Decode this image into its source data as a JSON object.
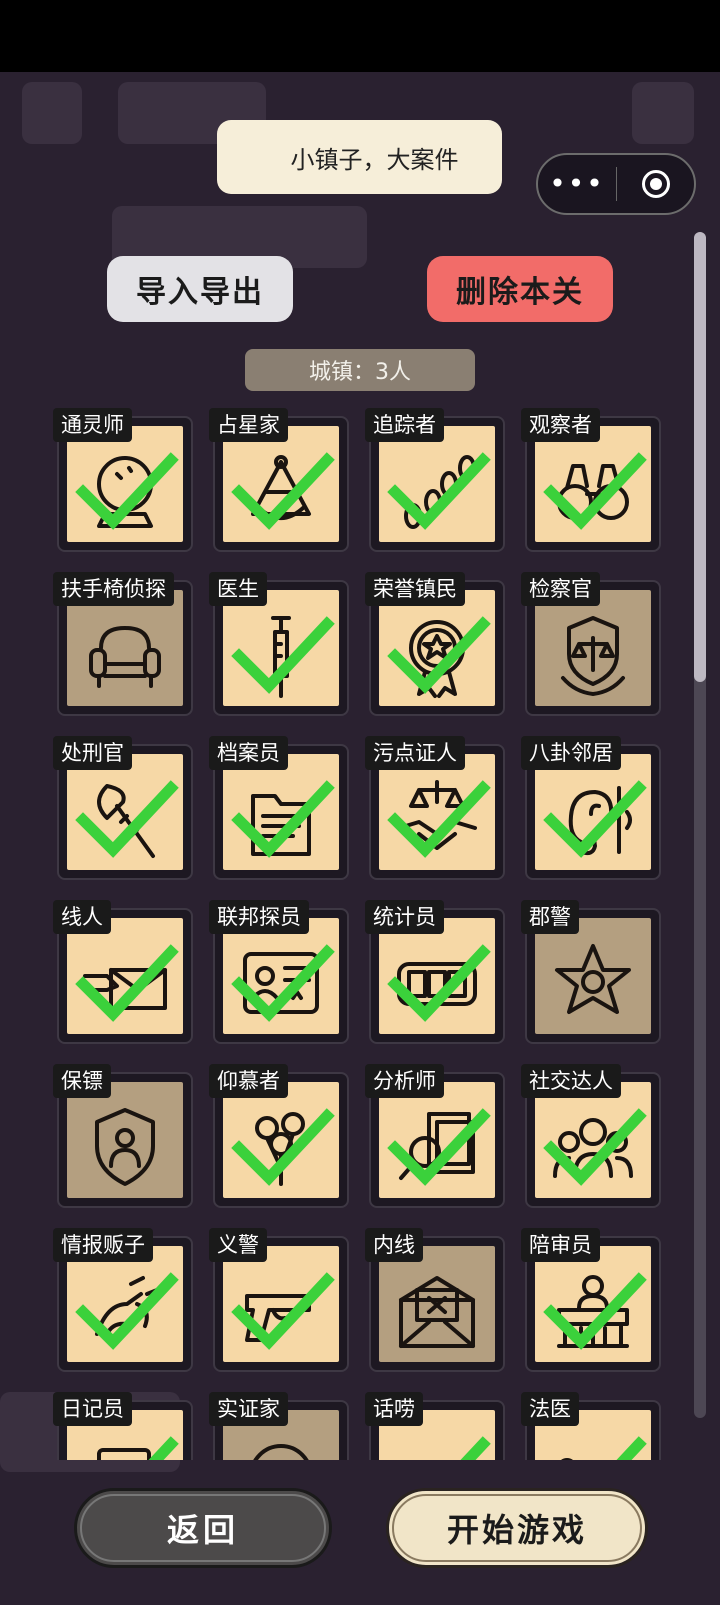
{
  "header": {
    "title": "小镇子，大案件",
    "more_icon": "more-dots-icon",
    "close_icon": "target-icon"
  },
  "actions": {
    "import_export": "导入导出",
    "delete_level": "删除本关"
  },
  "town_label": "城镇：3人",
  "colors": {
    "card_on": "#f6d8a6",
    "card_off": "#b49f80",
    "check": "#3bd13b",
    "delete_btn": "#f26c69"
  },
  "roles": [
    {
      "label": "通灵师",
      "icon": "crystal-ball-icon",
      "selected": true
    },
    {
      "label": "占星家",
      "icon": "sextant-icon",
      "selected": true
    },
    {
      "label": "追踪者",
      "icon": "footprints-icon",
      "selected": true
    },
    {
      "label": "观察者",
      "icon": "binoculars-icon",
      "selected": true
    },
    {
      "label": "扶手椅侦探",
      "icon": "armchair-icon",
      "selected": false
    },
    {
      "label": "医生",
      "icon": "syringe-icon",
      "selected": true
    },
    {
      "label": "荣誉镇民",
      "icon": "medal-icon",
      "selected": true
    },
    {
      "label": "检察官",
      "icon": "scales-shield-icon",
      "selected": false
    },
    {
      "label": "处刑官",
      "icon": "axe-icon",
      "selected": true
    },
    {
      "label": "档案员",
      "icon": "folder-icon",
      "selected": true
    },
    {
      "label": "污点证人",
      "icon": "handshake-icon",
      "selected": true
    },
    {
      "label": "八卦邻居",
      "icon": "ear-icon",
      "selected": true
    },
    {
      "label": "线人",
      "icon": "envelope-hand-icon",
      "selected": true
    },
    {
      "label": "联邦探员",
      "icon": "fbi-badge-icon",
      "selected": true
    },
    {
      "label": "统计员",
      "icon": "counter-icon",
      "selected": true
    },
    {
      "label": "郡警",
      "icon": "sheriff-star-icon",
      "selected": false
    },
    {
      "label": "保镖",
      "icon": "bodyguard-shield-icon",
      "selected": false
    },
    {
      "label": "仰慕者",
      "icon": "roses-icon",
      "selected": true
    },
    {
      "label": "分析师",
      "icon": "magnifier-docs-icon",
      "selected": true
    },
    {
      "label": "社交达人",
      "icon": "people-group-icon",
      "selected": true
    },
    {
      "label": "情报贩子",
      "icon": "whisper-icon",
      "selected": true
    },
    {
      "label": "义警",
      "icon": "pistol-icon",
      "selected": true
    },
    {
      "label": "内线",
      "icon": "envelope-x-icon",
      "selected": false
    },
    {
      "label": "陪审员",
      "icon": "judge-bench-icon",
      "selected": true
    },
    {
      "label": "日记员",
      "icon": "diary-icon",
      "selected": true
    },
    {
      "label": "实证家",
      "icon": "plus-circle-icon",
      "selected": false
    },
    {
      "label": "话唠",
      "icon": "lips-icon",
      "selected": true
    },
    {
      "label": "法医",
      "icon": "body-sheet-icon",
      "selected": true
    }
  ],
  "footer": {
    "back": "返回",
    "start": "开始游戏"
  }
}
